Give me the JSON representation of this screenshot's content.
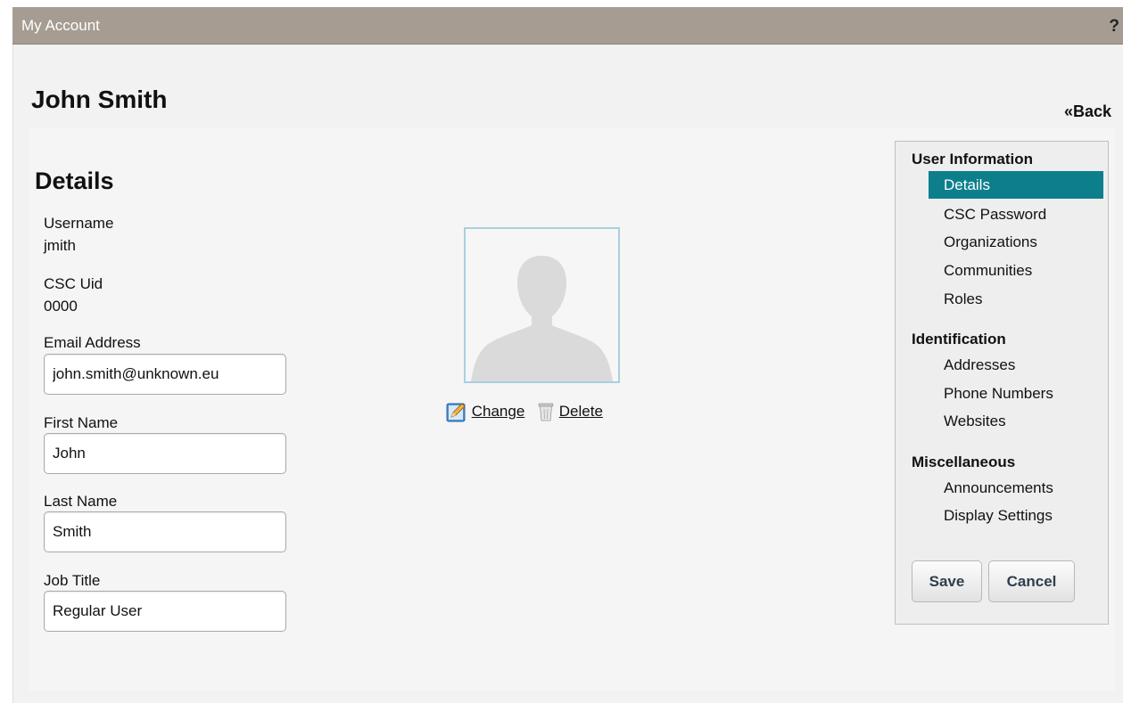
{
  "titlebar": {
    "title": "My Account",
    "help": "?"
  },
  "header": {
    "name": "John Smith",
    "back_label": "«Back"
  },
  "details": {
    "section_title": "Details",
    "username_label": "Username",
    "username_value": "jmith",
    "uid_label": "CSC Uid",
    "uid_value": "0000",
    "email_label": "Email Address",
    "email_value": "john.smith@unknown.eu",
    "first_name_label": "First Name",
    "first_name_value": "John",
    "last_name_label": "Last Name",
    "last_name_value": "Smith",
    "job_title_label": "Job Title",
    "job_title_value": "Regular User"
  },
  "photo": {
    "change_label": "Change",
    "delete_label": "Delete"
  },
  "nav": {
    "user_information": "User Information",
    "details": "Details",
    "csc_password": "CSC Password",
    "organizations": "Organizations",
    "communities": "Communities",
    "roles": "Roles",
    "identification": "Identification",
    "addresses": "Addresses",
    "phone_numbers": "Phone Numbers",
    "websites": "Websites",
    "miscellaneous": "Miscellaneous",
    "announcements": "Announcements",
    "display_settings": "Display Settings"
  },
  "buttons": {
    "save": "Save",
    "cancel": "Cancel"
  },
  "colors": {
    "titlebar": "#a69c91",
    "selected_nav": "#0d7f8c",
    "portrait_border": "#a8d0df"
  }
}
